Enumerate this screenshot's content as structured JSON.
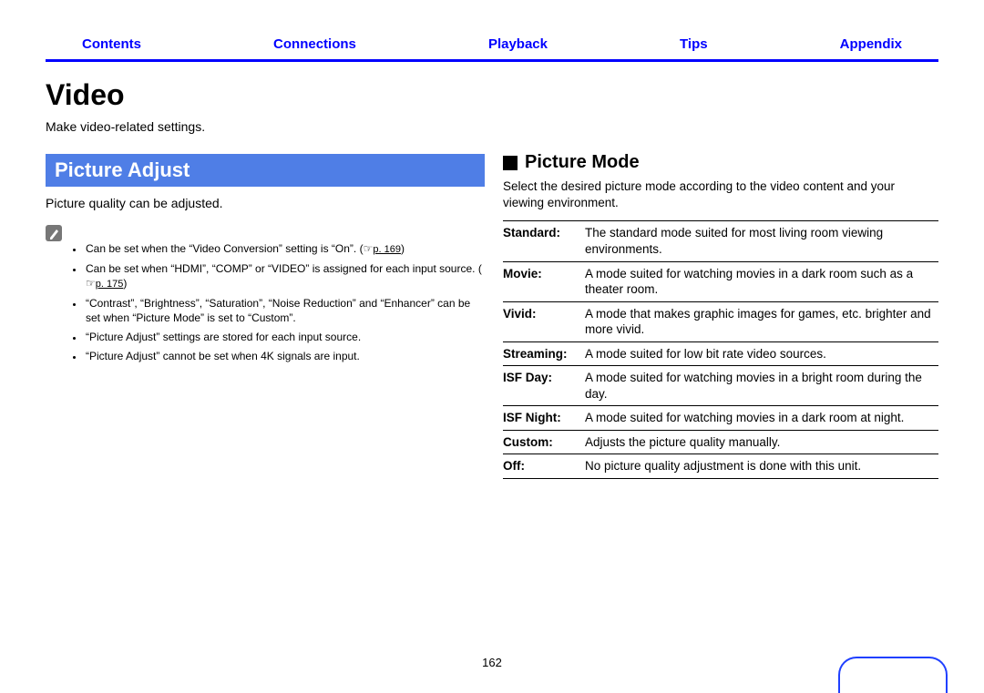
{
  "nav": {
    "contents": "Contents",
    "connections": "Connections",
    "playback": "Playback",
    "tips": "Tips",
    "appendix": "Appendix"
  },
  "title": "Video",
  "intro": "Make video-related settings.",
  "left": {
    "heading": "Picture Adjust",
    "desc": "Picture quality can be adjusted.",
    "notes": {
      "n1a": "Can be set when the “Video Conversion” setting is “On”.  (",
      "n1link": "p. 169",
      "n1b": ")",
      "n2a": "Can be set when “HDMI”, “COMP” or “VIDEO” is assigned for each input source. (",
      "n2link": "p. 175",
      "n2b": ")",
      "n3": "“Contrast”, “Brightness”, “Saturation”, “Noise Reduction” and “Enhancer” can be set when “Picture Mode” is set to “Custom”.",
      "n4": "“Picture Adjust” settings are stored for each input source.",
      "n5": "“Picture Adjust” cannot be set when 4K signals are input."
    }
  },
  "right": {
    "heading": "Picture Mode",
    "desc": "Select the desired picture mode according to the video content and your viewing environment.",
    "modes": [
      {
        "label": "Standard:",
        "text": "The standard mode suited for most living room viewing environments."
      },
      {
        "label": "Movie:",
        "text": "A mode suited for watching movies in a dark room such as a theater room."
      },
      {
        "label": "Vivid:",
        "text": "A mode that makes graphic images for games, etc. brighter and more vivid."
      },
      {
        "label": "Streaming:",
        "text": "A mode suited for low bit rate video sources."
      },
      {
        "label": "ISF Day:",
        "text": "A mode suited for watching movies in a bright room during the day."
      },
      {
        "label": "ISF Night:",
        "text": "A mode suited for watching movies in a dark room at night."
      },
      {
        "label": "Custom:",
        "text": "Adjusts the picture quality manually."
      },
      {
        "label": "Off:",
        "text": "No picture quality adjustment is done with this unit."
      }
    ]
  },
  "page_number": "162"
}
